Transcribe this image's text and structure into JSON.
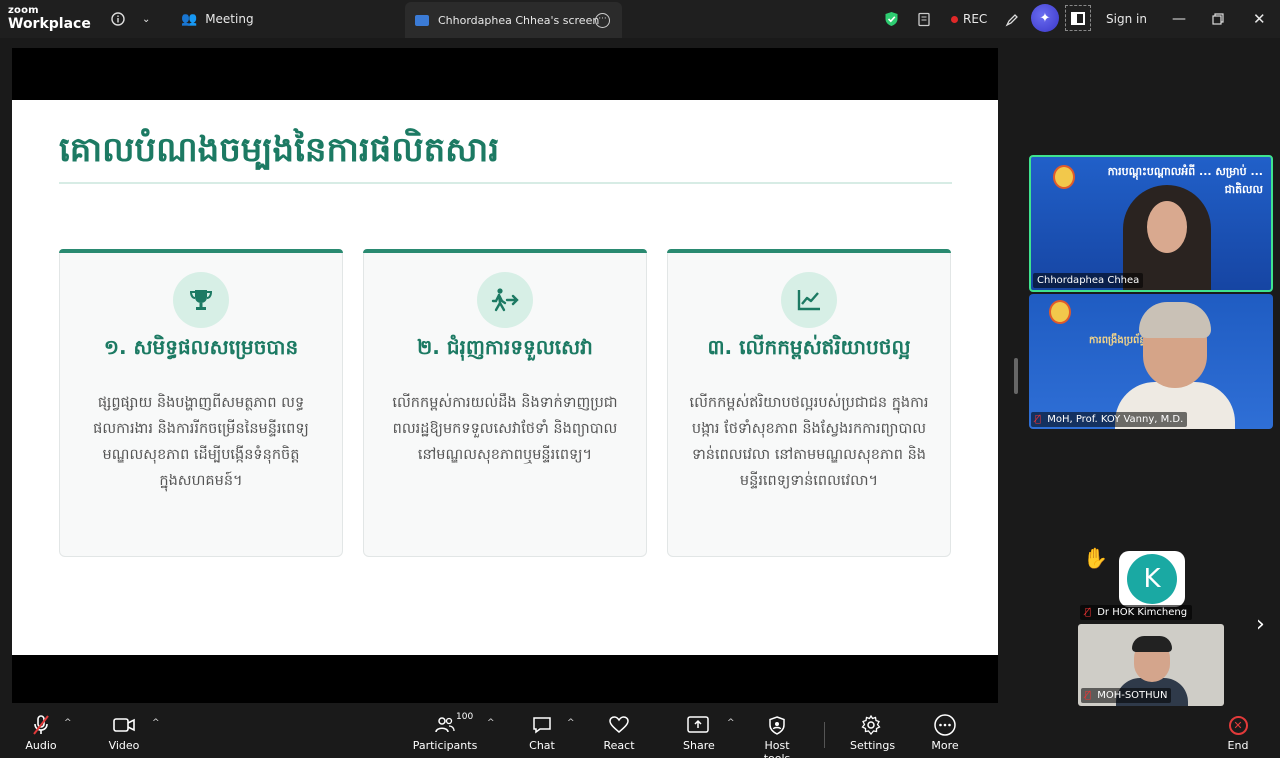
{
  "app": {
    "logo_top": "zoom",
    "logo_bottom": "Workplace"
  },
  "topbar": {
    "meeting_label": "Meeting",
    "share_tab_label": "Chhordaphea Chhea's screen",
    "rec_label": "REC",
    "sign_in_label": "Sign in"
  },
  "slide": {
    "title": "គោលបំណងចម្បងនៃការផលិតសារ",
    "cards": [
      {
        "title": "១. សមិទ្ធផលសម្រេចបាន",
        "body": "ផ្សព្វផ្សាយ និងបង្ហាញពីសមត្ថភាព លទ្ធផលការងារ និងការរីកចម្រើននៃមន្ទីរពេទ្យ មណ្ឌលសុខភាព ដើម្បីបង្កើនទំនុកចិត្តក្នុងសហគមន៍។",
        "icon": "trophy-icon"
      },
      {
        "title": "២. ជំរុញការទទួលសេវា",
        "body": "លើកកម្ពស់ការយល់ដឹង និងទាក់ទាញប្រជាពលរដ្ឋឱ្យមកទទួលសេវាថែទាំ និងព្យាបាលនៅមណ្ឌលសុខភាពឬមន្ទីរពេទ្យ។",
        "icon": "walking-person-icon"
      },
      {
        "title": "៣. លើកកម្ពស់ឥរិយាបថល្អ",
        "body": "លើកកម្ពស់ឥរិយាបថល្អរបស់ប្រជាជន ក្នុងការបង្ការ ថែទាំសុខភាព និងស្វែងរកការព្យាបាលទាន់ពេលវេលា នៅតាមមណ្ឌលសុខភាព និងមន្ទីរពេទ្យទាន់ពេលវេលា។",
        "icon": "line-chart-icon"
      }
    ]
  },
  "participants_panel": {
    "video1": {
      "name": "Chhordaphea Chhea",
      "banner": "ការបណ្តុះបណ្តាលអំពី ... សម្រាប់ ... ជាតិលល"
    },
    "video2": {
      "name": "MoH, Prof. KOY Vanny, M.D.",
      "banner": "ការពង្រឹងប្រព័ន្ធ ... ជាតិ"
    },
    "avatar_k": {
      "initial": "K",
      "name": "Dr HOK Kimcheng"
    },
    "video3": {
      "name": "MOH-SOTHUN"
    }
  },
  "toolbar": {
    "audio": "Audio",
    "video": "Video",
    "participants": "Participants",
    "participants_count": "100",
    "chat": "Chat",
    "react": "React",
    "share": "Share",
    "host_tools": "Host tools",
    "settings": "Settings",
    "more": "More",
    "end": "End"
  },
  "colors": {
    "accent_green": "#1c7a63",
    "card_top": "#2a8a71",
    "active_speaker_border": "#3fe38f",
    "end_red": "#e23a3a"
  }
}
